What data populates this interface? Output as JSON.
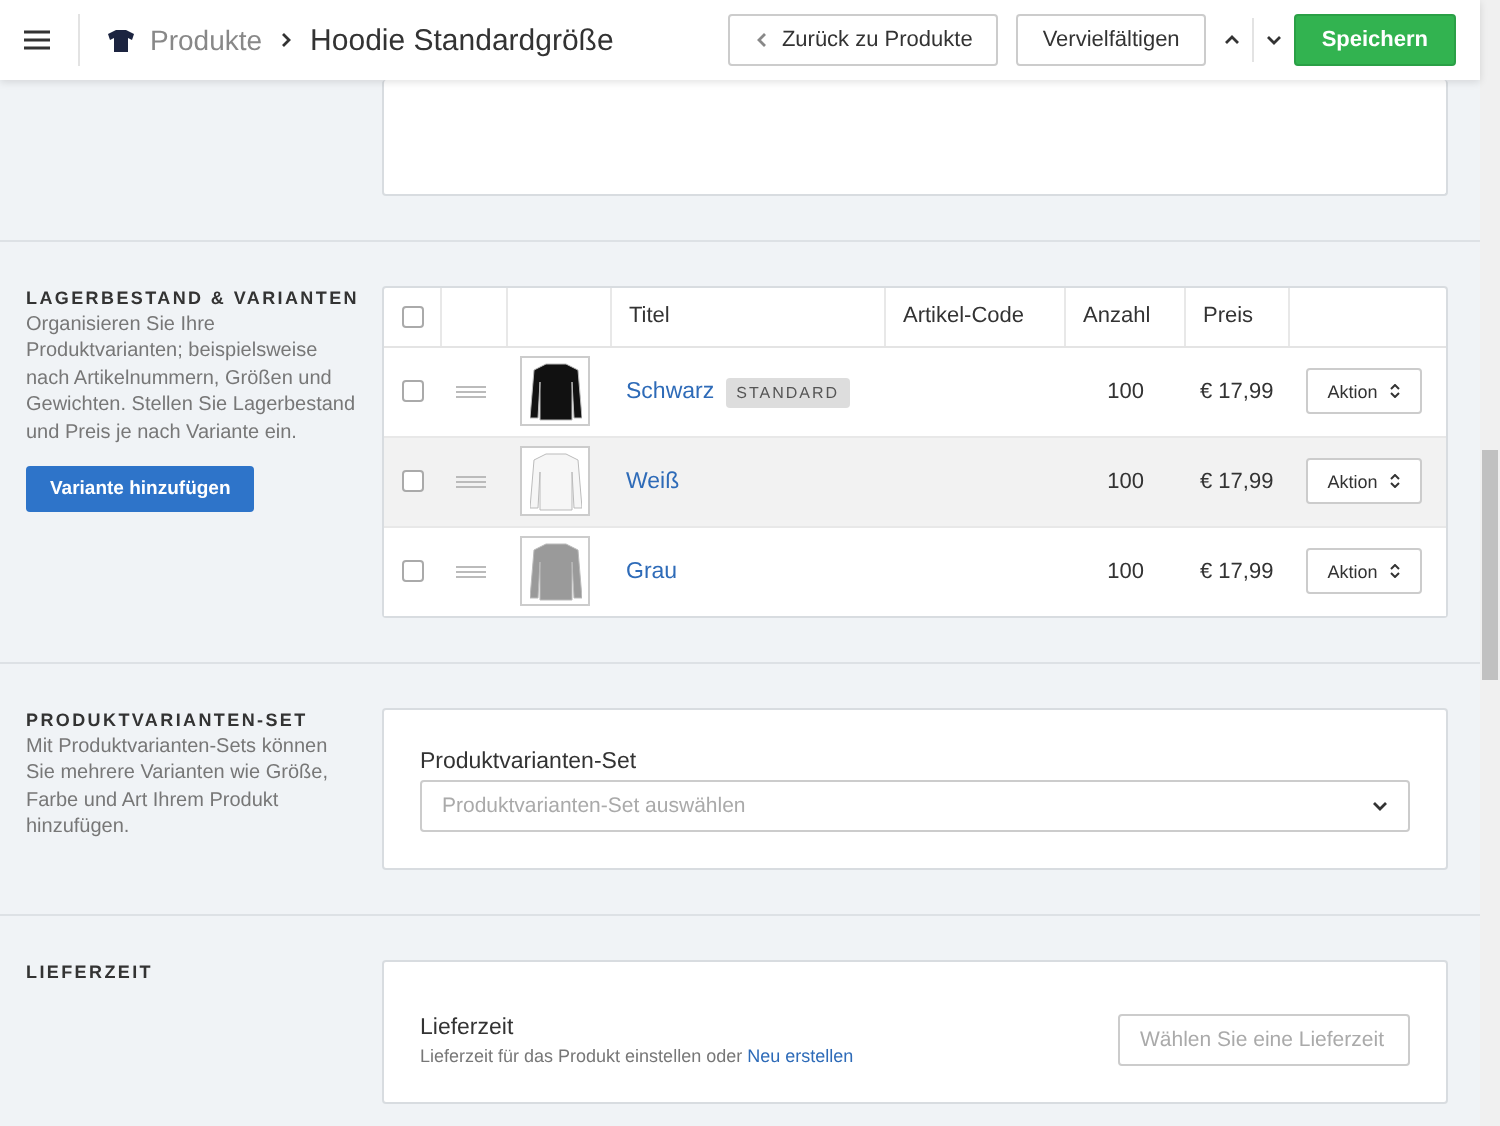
{
  "header": {
    "breadcrumb": [
      {
        "label": "Produkte",
        "kind": "link"
      },
      {
        "label": "Hoodie Standardgröße",
        "kind": "current"
      }
    ],
    "back_button": "Zurück zu Produkte",
    "duplicate_button": "Vervielfältigen",
    "save_button": "Speichern"
  },
  "variants_section": {
    "title": "LAGERBESTAND & VARIANTEN",
    "description": "Organisieren Sie Ihre Produktvarianten; beispielsweise nach Artikelnummern, Größen und Gewichten. Stellen Sie Lagerbestand und Preis je nach Variante ein.",
    "add_button": "Variante hinzufügen",
    "table": {
      "columns": [
        "Titel",
        "Artikel-Code",
        "Anzahl",
        "Preis"
      ],
      "all_checked": false,
      "rows": [
        {
          "checked": false,
          "highlighted": false,
          "color": "#111111",
          "title": "Schwarz",
          "badge": "STANDARD",
          "count": "100",
          "price": "€ 17,99",
          "action": "Aktion"
        },
        {
          "checked": false,
          "highlighted": true,
          "color": "#f6f6f6",
          "title": "Weiß",
          "count": "100",
          "price": "€ 17,99",
          "action": "Aktion"
        },
        {
          "checked": false,
          "highlighted": false,
          "color": "#9a9a9a",
          "title": "Grau",
          "count": "100",
          "price": "€ 17,99",
          "action": "Aktion"
        }
      ]
    }
  },
  "variant_set_section": {
    "title": "PRODUKTVARIANTEN-SET",
    "description": "Mit Produktvarianten-Sets können Sie mehrere Varianten wie Größe, Farbe und Art Ihrem Produkt hinzufügen.",
    "field_label": "Produktvarianten-Set",
    "placeholder": "Produktvarianten-Set auswählen"
  },
  "delivery_section": {
    "title": "LIEFERZEIT",
    "field_label": "Lieferzeit",
    "help": "Lieferzeit für das Produkt einstellen oder ",
    "help_link": "Neu erstellen",
    "placeholder": "Wählen Sie eine Lieferzeit"
  }
}
